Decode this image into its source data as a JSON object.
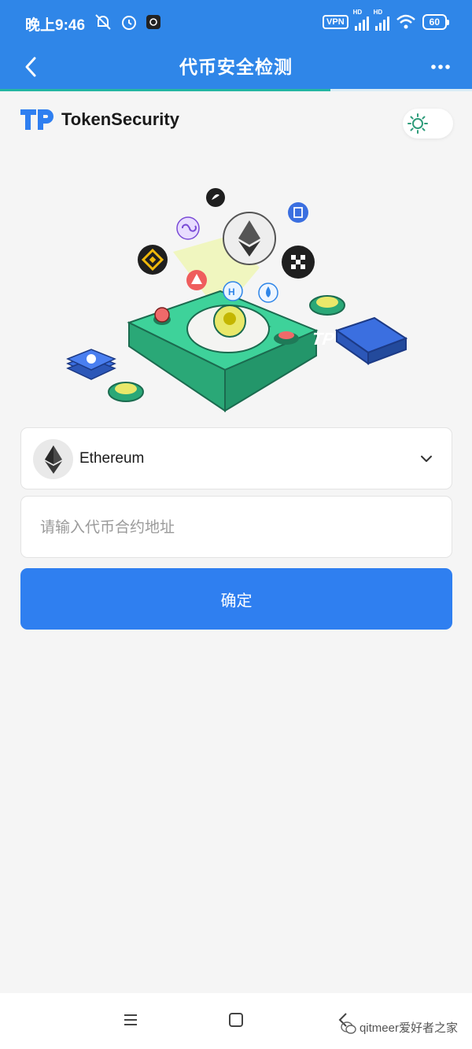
{
  "status_bar": {
    "time": "晚上9:46",
    "vpn": "VPN",
    "hd1": "HD",
    "hd2": "HD",
    "battery": "60"
  },
  "header": {
    "title": "代币安全检测",
    "back_icon": "back-arrow-icon",
    "more_icon": "more-dots-icon",
    "page_load_progress": 0.7
  },
  "brand": {
    "logo_text": "TP",
    "name": "TokenSecurity"
  },
  "theme_toggle_icon": "sun-icon",
  "hero": {
    "badge_text": "TP"
  },
  "chain_select": {
    "selected": "Ethereum",
    "icon": "ethereum-icon"
  },
  "address_input": {
    "placeholder": "请输入代币合约地址",
    "value": ""
  },
  "confirm_button": {
    "label": "确定"
  },
  "system_nav": {
    "menu_icon": "menu-icon",
    "home_icon": "home-square-icon",
    "back_icon": "back-gesture-icon"
  },
  "watermark": {
    "text": "qitmeer爱好者之家"
  },
  "colors": {
    "primary": "#2f86e8",
    "button": "#2f7ff0",
    "accent_green": "#3cc48b",
    "progress": "#24b6a1",
    "background": "#f5f5f5"
  }
}
